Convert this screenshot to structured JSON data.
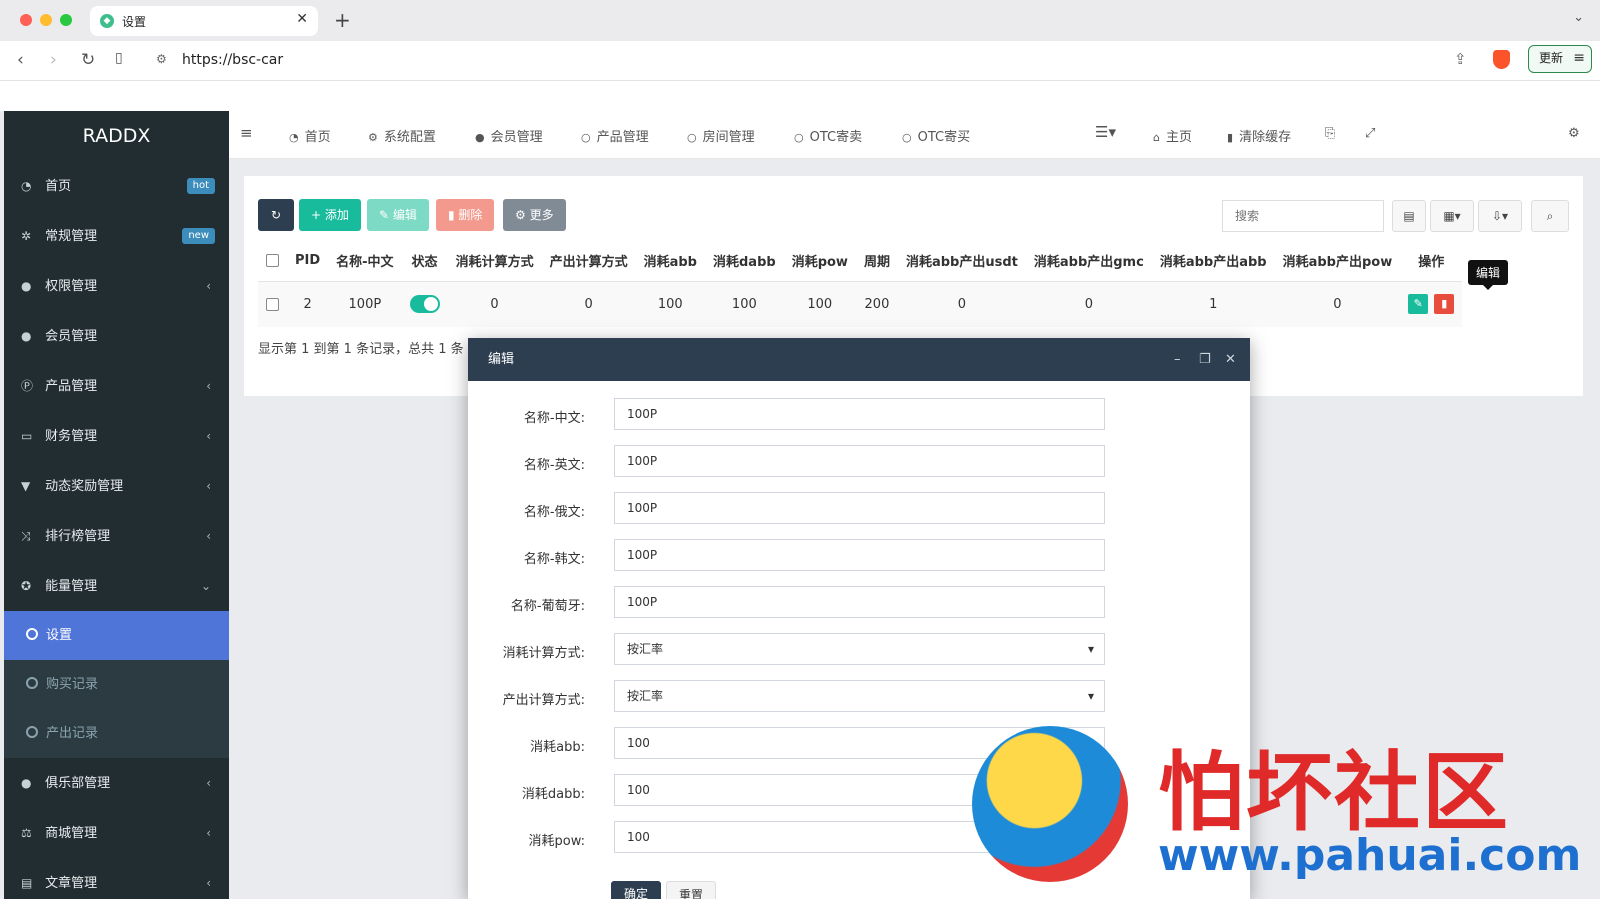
{
  "browser": {
    "tab_title": "设置",
    "url": "https://bsc-car",
    "update_label": "更新"
  },
  "app": {
    "logo": "RADDX"
  },
  "sidebar": {
    "items": [
      {
        "label": "首页",
        "icon": "dashboard-icon",
        "badge": "hot"
      },
      {
        "label": "常规管理",
        "icon": "cogs-icon",
        "badge": "new"
      },
      {
        "label": "权限管理",
        "icon": "users-icon",
        "chevron": "‹"
      },
      {
        "label": "会员管理",
        "icon": "user-icon"
      },
      {
        "label": "产品管理",
        "icon": "product-icon",
        "chevron": "‹"
      },
      {
        "label": "财务管理",
        "icon": "credit-card-icon",
        "chevron": "‹"
      },
      {
        "label": "动态奖励管理",
        "icon": "trophy-icon",
        "chevron": "‹"
      },
      {
        "label": "排行榜管理",
        "icon": "random-icon",
        "chevron": "‹"
      },
      {
        "label": "能量管理",
        "icon": "energy-icon",
        "chevron": "⌄"
      }
    ],
    "subitems": [
      {
        "label": "设置",
        "active": true
      },
      {
        "label": "购买记录",
        "active": false
      },
      {
        "label": "产出记录",
        "active": false
      }
    ],
    "items_after": [
      {
        "label": "俱乐部管理",
        "icon": "club-icon",
        "chevron": "‹"
      },
      {
        "label": "商城管理",
        "icon": "balance-icon",
        "chevron": "‹"
      },
      {
        "label": "文章管理",
        "icon": "newspaper-icon",
        "chevron": "‹"
      }
    ]
  },
  "topnav": {
    "items": [
      "首页",
      "系统配置",
      "会员管理",
      "产品管理",
      "房间管理",
      "OTC寄卖",
      "OTC寄买"
    ],
    "right": [
      "主页",
      "清除缓存"
    ]
  },
  "toolbar": {
    "add": "添加",
    "edit": "编辑",
    "delete": "删除",
    "more": "更多",
    "search_placeholder": "搜索"
  },
  "table": {
    "headers": [
      "PID",
      "名称-中文",
      "状态",
      "消耗计算方式",
      "产出计算方式",
      "消耗abb",
      "消耗dabb",
      "消耗pow",
      "周期",
      "消耗abb产出usdt",
      "消耗abb产出gmc",
      "消耗abb产出abb",
      "消耗abb产出pow",
      "操作"
    ],
    "rows": [
      {
        "pid": "2",
        "name": "100P",
        "status": "on",
        "cost_mode": "0",
        "output_mode": "0",
        "abb": "100",
        "dabb": "100",
        "pow": "100",
        "period": "200",
        "usdt": "0",
        "gmc": "0",
        "abb_out": "1",
        "pow_out": "0"
      }
    ],
    "tooltip": "编辑",
    "page_info": "显示第 1 到第 1 条记录，总共 1 条"
  },
  "modal": {
    "title": "编辑",
    "fields": [
      {
        "label": "名称-中文:",
        "value": "100P",
        "type": "text"
      },
      {
        "label": "名称-英文:",
        "value": "100P",
        "type": "text"
      },
      {
        "label": "名称-俄文:",
        "value": "100P",
        "type": "text"
      },
      {
        "label": "名称-韩文:",
        "value": "100P",
        "type": "text"
      },
      {
        "label": "名称-葡萄牙:",
        "value": "100P",
        "type": "text"
      },
      {
        "label": "消耗计算方式:",
        "value": "按汇率",
        "type": "select"
      },
      {
        "label": "产出计算方式:",
        "value": "按汇率",
        "type": "select"
      },
      {
        "label": "消耗abb:",
        "value": "100",
        "type": "text"
      },
      {
        "label": "消耗dabb:",
        "value": "100",
        "type": "text"
      },
      {
        "label": "消耗pow:",
        "value": "100",
        "type": "text"
      }
    ],
    "ok_label": "确定",
    "reset_label": "重置"
  },
  "watermark": {
    "title": "怕坏社区",
    "url": "www.pahuai.com"
  },
  "colors": {
    "sidebar_bg": "#222d32",
    "active_item": "#5075d9",
    "success": "#18bc9c",
    "danger": "#e74c3c",
    "header_dark": "#2c3e50"
  }
}
